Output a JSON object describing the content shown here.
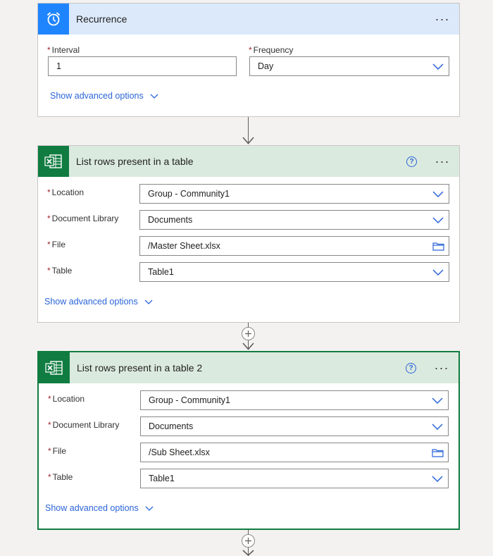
{
  "recurrence": {
    "title": "Recurrence",
    "interval_label": "Interval",
    "interval_value": "1",
    "frequency_label": "Frequency",
    "frequency_value": "Day",
    "advanced": "Show advanced options",
    "more": "···"
  },
  "list1": {
    "title": "List rows present in a table",
    "help": "?",
    "more": "···",
    "location_label": "Location",
    "location_value": "Group - Community1",
    "library_label": "Document Library",
    "library_value": "Documents",
    "file_label": "File",
    "file_value": "/Master Sheet.xlsx",
    "table_label": "Table",
    "table_value": "Table1",
    "advanced": "Show advanced options"
  },
  "list2": {
    "title": "List rows present in a table 2",
    "help": "?",
    "more": "···",
    "location_label": "Location",
    "location_value": "Group - Community1",
    "library_label": "Document Library",
    "library_value": "Documents",
    "file_label": "File",
    "file_value": "/Sub Sheet.xlsx",
    "table_label": "Table",
    "table_value": "Table1",
    "advanced": "Show advanced options"
  },
  "required_mark": "*",
  "colors": {
    "recurrence_header": "#dce9fb",
    "recurrence_icon_bg": "#1f85ff",
    "excel_header": "#dbeadf",
    "excel_icon_bg": "#107c41",
    "link": "#2b65d9",
    "required": "#a4262c"
  }
}
